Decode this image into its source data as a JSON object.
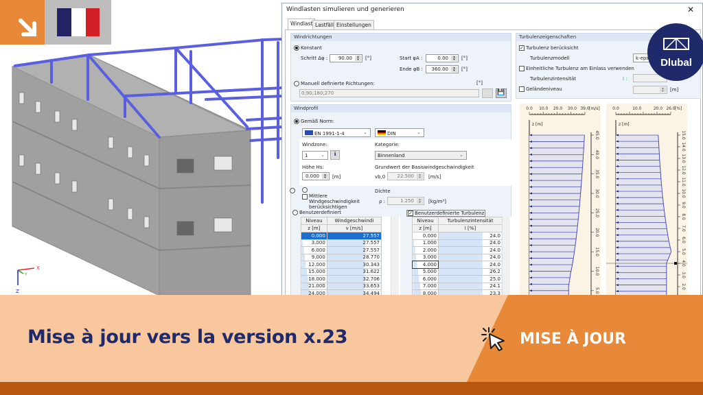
{
  "colors": {
    "orange": "#e8893a",
    "navy": "#1f2a6b",
    "peach": "#f8c79d",
    "profile": "#4a4fb8"
  },
  "badge": {
    "icon": "arrow-down-right-icon",
    "flag": "france-flag"
  },
  "model": {
    "axes": {
      "x": "X",
      "y": "Y",
      "z": "Z"
    }
  },
  "dialog": {
    "title": "Windlasten simulieren und generieren",
    "tabs": [
      "Windlast",
      "Lastfälle",
      "Einstellungen"
    ],
    "windrichtungen": {
      "header": "Windrichtungen",
      "konstant": "Konstant",
      "schritt_label": "Schritt Δφ :",
      "schritt": "90.00",
      "deg": "[°]",
      "start_label": "Start φA :",
      "start": "0.00",
      "ende_label": "Ende φB :",
      "ende": "360.00",
      "manuell": "Manuell definierte Richtungen:",
      "manuell_value": "0;90;180;270"
    },
    "windprofil": {
      "header": "Windprofil",
      "gemaess": "Gemäß Norm:",
      "norm": "EN 1991-1-4",
      "annex": "DIN",
      "windzone_label": "Windzone:",
      "windzone": "1",
      "kategorie_label": "Kategorie:",
      "kategorie": "Binnenland",
      "hoehe_label": "Höhe Hs:",
      "hoehe": "0.000",
      "m": "[m]",
      "grundwert_label": "Grundwert der Basiswindgeschwindigkeit",
      "vb0_label": "vb,0 :",
      "vb0": "22.500",
      "ms": "[m/s]",
      "dichte_label": "Dichte",
      "rho_label": "ρ :",
      "rho": "1.250",
      "kgm3": "[kg/m³]",
      "mittlere": "Mittlere Windgeschwindigkeit berücksichtigen",
      "benutzer": "Benutzerdefiniert",
      "benutzer_turb": "Benutzerdefinierte Turbulenz"
    },
    "wind_table": {
      "headers": [
        [
          "Niveau",
          "z [m]"
        ],
        [
          "Windgeschwindi",
          "v [m/s]"
        ]
      ],
      "rows": [
        [
          "0.000",
          "27.557"
        ],
        [
          "3.000",
          "27.557"
        ],
        [
          "6.000",
          "27.557"
        ],
        [
          "9.000",
          "28.770"
        ],
        [
          "12.000",
          "30.343"
        ],
        [
          "15.000",
          "31.622"
        ],
        [
          "18.000",
          "32.706"
        ],
        [
          "21.000",
          "33.653"
        ],
        [
          "24.000",
          "34.494"
        ]
      ]
    },
    "turb_table": {
      "headers": [
        [
          "Niveau",
          "z [m]"
        ],
        [
          "Turbulenzintensität",
          "I [%]"
        ]
      ],
      "rows": [
        [
          "0.000",
          "24.0"
        ],
        [
          "1.000",
          "24.0"
        ],
        [
          "2.000",
          "24.0"
        ],
        [
          "3.000",
          "24.0"
        ],
        [
          "4.000",
          "24.0"
        ],
        [
          "5.000",
          "26.2"
        ],
        [
          "6.000",
          "25.0"
        ],
        [
          "7.000",
          "24.1"
        ],
        [
          "8.000",
          "23.3"
        ]
      ]
    },
    "turbulenz": {
      "header": "Turbulenzeigenschaften",
      "beruecksicht": "Turbulenz berücksicht",
      "modell_label": "Turbulenzmodell",
      "modell": "k-epsilo",
      "einheitlich": "Einheitliche Turbulenz am Einlass verwenden",
      "intensitaet_label": "Turbulenzintensität",
      "i_label": "I :",
      "gelaende": "Geländeniveau",
      "m": "[m]"
    }
  },
  "chart_data": [
    {
      "type": "line",
      "title": "Windgeschwindigkeit",
      "xlabel": "[m/s]",
      "ylabel": "z [m]",
      "xticks": [
        "0.0",
        "10.0",
        "20.0",
        "30.0",
        "39.0"
      ],
      "xlim": [
        0,
        39
      ],
      "ylim": [
        0,
        45
      ],
      "yticks": [
        "5.0",
        "10.0",
        "15.0",
        "20.0",
        "25.0",
        "30.0",
        "35.0",
        "40.0",
        "45.0"
      ],
      "z": [
        0,
        3,
        6,
        9,
        12,
        15,
        18,
        21,
        24,
        27,
        30,
        33,
        36,
        39,
        42,
        45
      ],
      "values": [
        27.557,
        27.557,
        27.557,
        28.77,
        30.343,
        31.622,
        32.706,
        33.653,
        34.494,
        35.25,
        35.94,
        36.58,
        37.17,
        37.72,
        38.24,
        38.73
      ]
    },
    {
      "type": "line",
      "title": "Turbulenzintensität",
      "xlabel": "[%]",
      "ylabel": "z [m]",
      "xticks": [
        "0.0",
        "10.0",
        "20.0",
        "26.0"
      ],
      "xlim": [
        0,
        26
      ],
      "ylim": [
        0,
        15
      ],
      "yticks": [
        "2.0",
        "3.0",
        "4.0",
        "5.0",
        "6.0",
        "7.0",
        "8.0",
        "9.0",
        "10.0",
        "11.0",
        "12.0",
        "13.0",
        "14.0",
        "15.0"
      ],
      "z": [
        0,
        1,
        2,
        3,
        4,
        5,
        6,
        7,
        8,
        9,
        10,
        11,
        12,
        13,
        14,
        15
      ],
      "values": [
        24.0,
        24.0,
        24.0,
        24.0,
        24.0,
        26.2,
        25.0,
        24.1,
        23.3,
        22.6,
        22.0,
        21.5,
        21.1,
        20.7,
        20.4,
        20.1
      ]
    }
  ],
  "logo": {
    "text": "Dlubal"
  },
  "banner": {
    "headline": "Mise à jour vers la version x.23",
    "cta": "MISE À JOUR",
    "cta_icon": "click-cursor-icon"
  }
}
